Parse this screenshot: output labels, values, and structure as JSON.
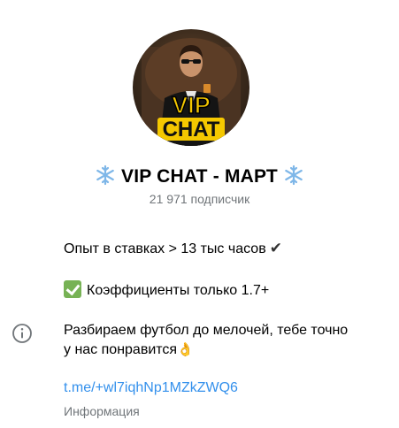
{
  "channel": {
    "title": "VIP CHAT - МАРТ",
    "title_emoji": "snowflake-icon",
    "avatar_text_line1": "VIP",
    "avatar_text_line2": "CHAT",
    "subscribers": "21 971 подписчик"
  },
  "description": {
    "line1": "Опыт в ставках > 13 тыс часов",
    "line1_icon": "check-mark-icon",
    "line2": "Коэффициенты только 1.7+",
    "line2_icon": "green-check-icon",
    "line3a": "Разбираем футбол до мелочей, тебе точно",
    "line3b": "у нас понравится",
    "line3_icon": "ok-hand-icon"
  },
  "link": {
    "text": "t.me/+wl7iqhNp1MZkZWQ6"
  },
  "info_label": "Информация",
  "colors": {
    "link": "#3390ec",
    "secondary_text": "#707579",
    "badge_yellow": "#f5c800"
  }
}
